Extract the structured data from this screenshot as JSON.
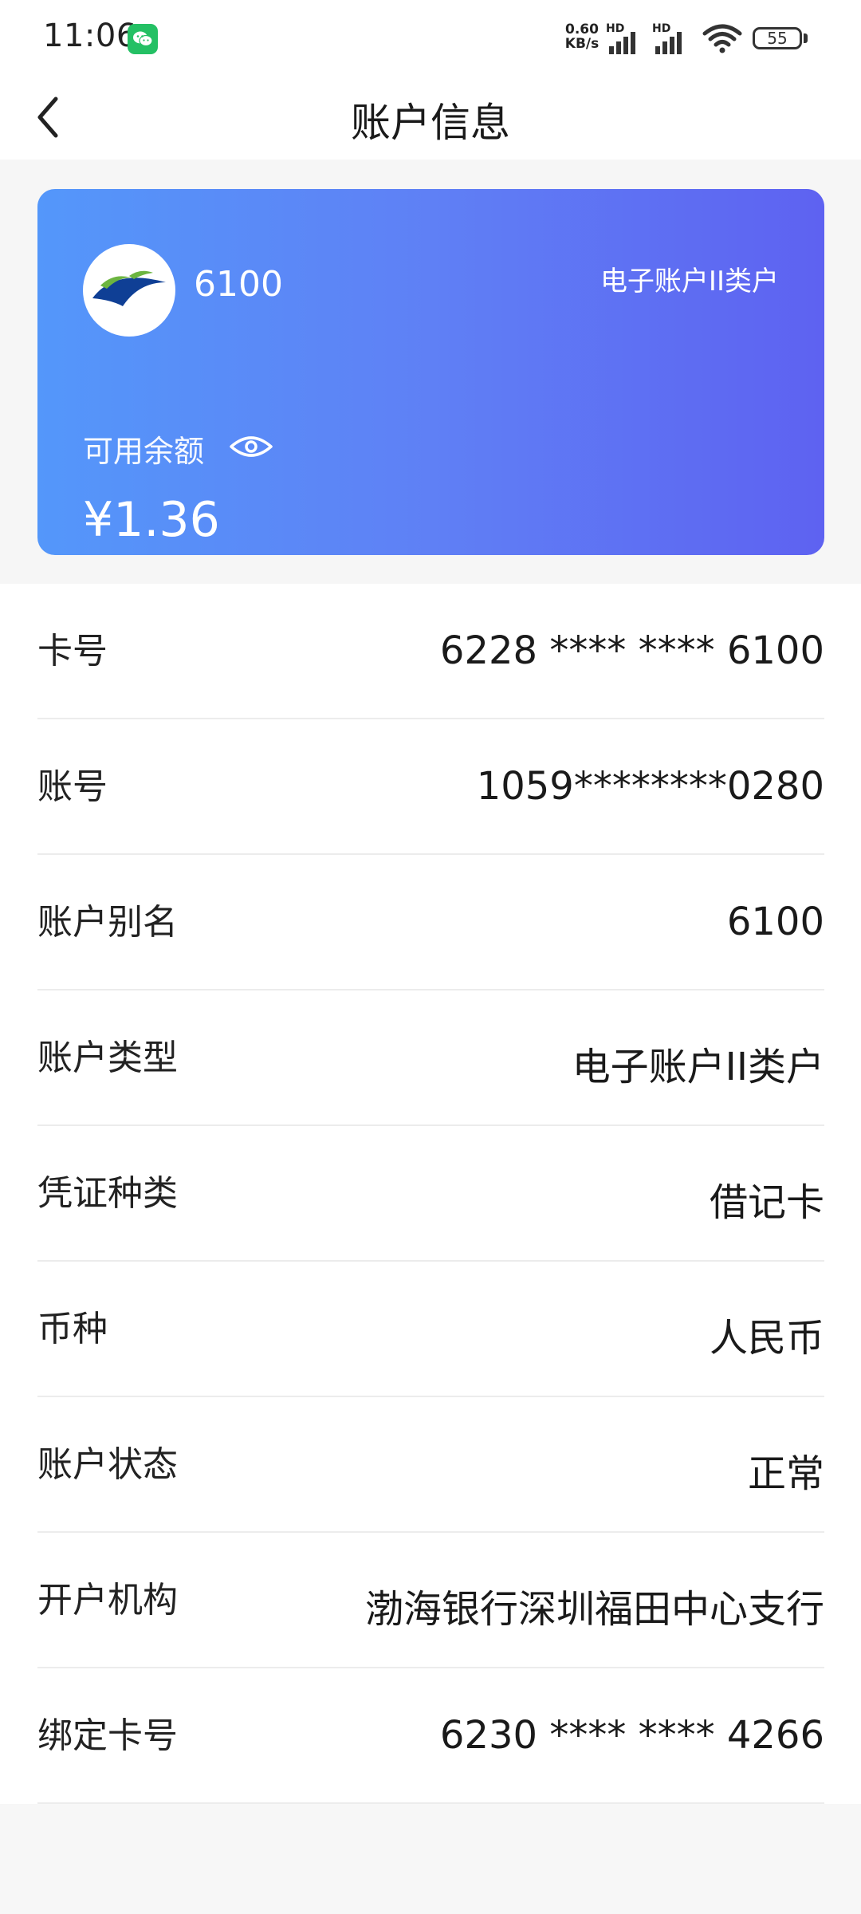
{
  "status_bar": {
    "time": "11:06",
    "net_speed_value": "0.60",
    "net_speed_unit": "KB/s",
    "signal1_label": "HD",
    "signal2_label": "HD",
    "battery": "55"
  },
  "nav": {
    "title": "账户信息"
  },
  "card": {
    "alias": "6100",
    "account_type": "电子账户II类户",
    "balance_label": "可用余额",
    "balance_value": "¥1.36",
    "colors": {
      "gradient_start": "#5497fa",
      "gradient_end": "#5e62f1"
    }
  },
  "info": {
    "rows": [
      {
        "label": "卡号",
        "value": "6228 **** **** 6100"
      },
      {
        "label": "账号",
        "value": "1059********0280"
      },
      {
        "label": "账户别名",
        "value": "6100"
      },
      {
        "label": "账户类型",
        "value": "电子账户II类户"
      },
      {
        "label": "凭证种类",
        "value": "借记卡"
      },
      {
        "label": "币种",
        "value": "人民币"
      },
      {
        "label": "账户状态",
        "value": "正常"
      },
      {
        "label": "开户机构",
        "value": "渤海银行深圳福田中心支行"
      },
      {
        "label": "绑定卡号",
        "value": "6230 **** **** 4266"
      }
    ]
  },
  "icons": {
    "back": "chevron-left-icon",
    "eye": "eye-icon",
    "wechat": "wechat-icon",
    "wifi": "wifi-icon",
    "signal": "signal-icon",
    "battery": "battery-icon",
    "bank_logo": "bank-logo"
  }
}
